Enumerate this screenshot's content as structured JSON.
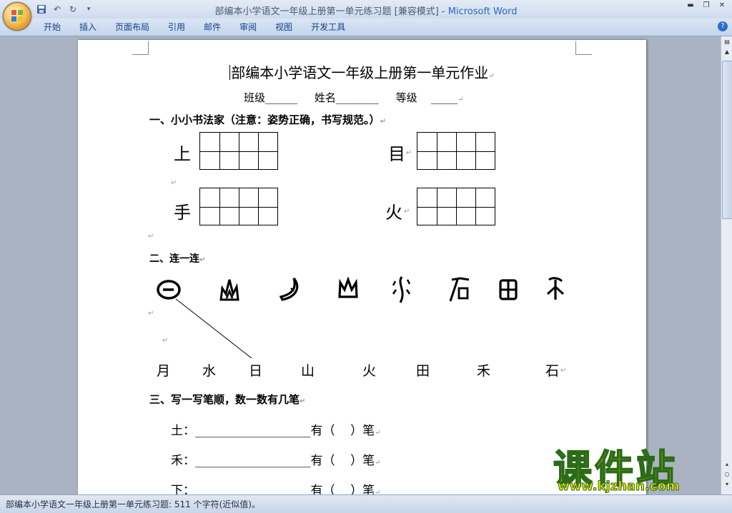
{
  "window": {
    "title_doc": "部编本小学语文一年级上册第一单元练习题 [兼容模式]",
    "title_sep": " - ",
    "title_app": "Microsoft Word"
  },
  "ribbon": {
    "tabs": [
      "开始",
      "插入",
      "页面布局",
      "引用",
      "邮件",
      "审阅",
      "视图",
      "开发工具"
    ],
    "help": "?"
  },
  "document": {
    "title": "部编本小学语文一年级上册第一单元作业",
    "info_line": "班级______     姓名________     等级    _____",
    "section1": "一、小小书法家（注意：姿势正确，书写规范。）",
    "section1_chars": [
      "上",
      "目",
      "手",
      "火"
    ],
    "section2": "二、连一连",
    "section2_chars": [
      "月",
      "水",
      "日",
      "山",
      "火",
      "田",
      "禾",
      "石"
    ],
    "section3": "三、写一写笔顺，数一数有几笔",
    "section3_rows": [
      {
        "char": "土：",
        "blank": "___________________",
        "suffix": "有（    ）笔"
      },
      {
        "char": "禾：",
        "blank": "___________________",
        "suffix": "有（    ）笔"
      },
      {
        "char": "下：",
        "blank": "___________________",
        "suffix": "有（    ）笔"
      }
    ],
    "paragraph_mark": "↵"
  },
  "statusbar": {
    "text": "部编本小学语文一年级上册第一单元练习题: 511 个字符(近似值)。"
  },
  "watermark": {
    "cn": "课件站",
    "url": "www.kjzhan.com"
  }
}
